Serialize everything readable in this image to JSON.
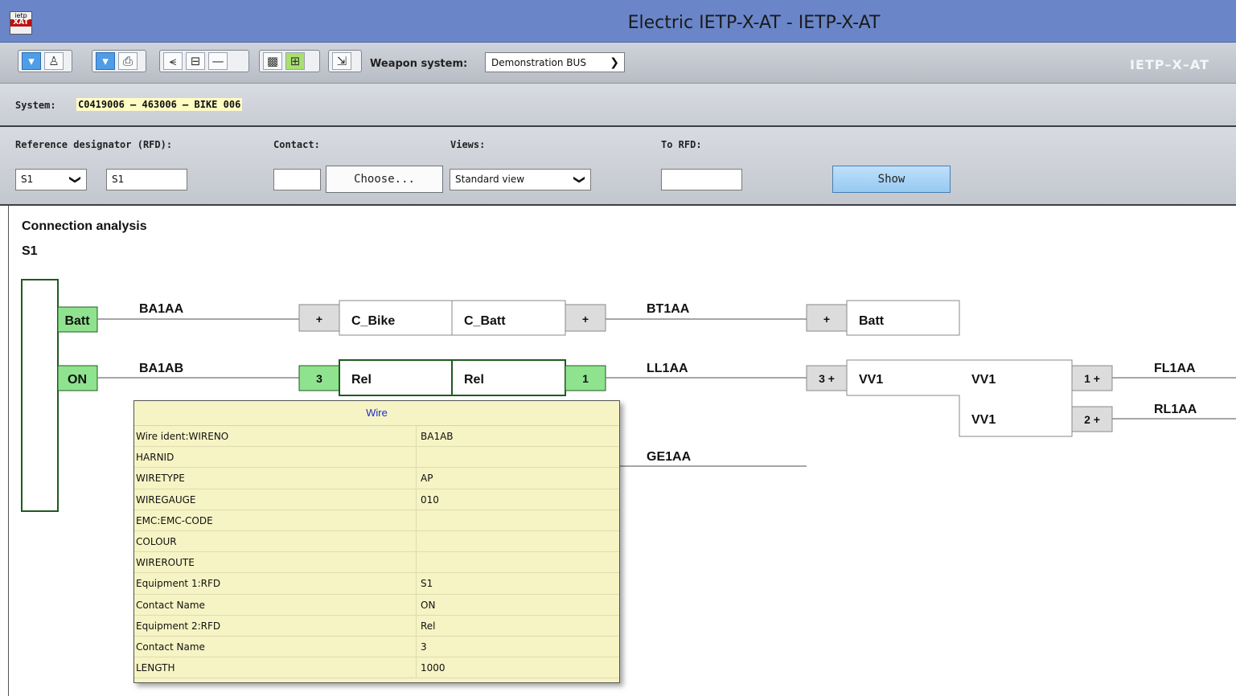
{
  "window": {
    "title": "Electric IETP-X-AT - IETP-X-AT",
    "logo_top": "ietp",
    "logo_bottom": "XAT"
  },
  "toolbar": {
    "weapon_label": "Weapon system:",
    "weapon_value": "Demonstration BUS",
    "brand": "IETP–X–AT"
  },
  "system": {
    "label": "System:",
    "value": "C0419006 – 463006 – BIKE 006"
  },
  "form": {
    "rfd_label": "Reference designator (RFD):",
    "rfd_select": "S1",
    "rfd_value": "S1",
    "contact_label": "Contact:",
    "contact_value": "",
    "choose_label": "Choose...",
    "views_label": "Views:",
    "views_value": "Standard view",
    "to_rfd_label": "To RFD:",
    "to_rfd_value": "",
    "show_label": "Show"
  },
  "content": {
    "heading": "Connection analysis",
    "subheading": "S1"
  },
  "diagram": {
    "pins_left": [
      "Batt",
      "ON"
    ],
    "wires": [
      "BA1AA",
      "BA1AB",
      "BT1AA",
      "LL1AA",
      "GE1AA",
      "FL1AA",
      "RL1AA"
    ],
    "pins": [
      "+",
      "+",
      "+",
      "3",
      "1",
      "3 +",
      "1 +",
      "2 +"
    ],
    "components": [
      "C_Bike",
      "C_Batt",
      "Batt",
      "Rel",
      "Rel",
      "VV1",
      "VV1",
      "VV1"
    ]
  },
  "popup": {
    "title": "Wire",
    "rows": [
      {
        "key": "Wire ident:WIRENO",
        "value": "BA1AB"
      },
      {
        "key": "HARNID",
        "value": ""
      },
      {
        "key": "WIRETYPE",
        "value": "AP"
      },
      {
        "key": "WIREGAUGE",
        "value": "010"
      },
      {
        "key": "EMC:EMC-CODE",
        "value": ""
      },
      {
        "key": "COLOUR",
        "value": ""
      },
      {
        "key": "WIREROUTE",
        "value": ""
      },
      {
        "key": "Equipment 1:RFD",
        "value": "S1"
      },
      {
        "key": "Contact Name",
        "value": "ON"
      },
      {
        "key": "Equipment 2:RFD",
        "value": "Rel"
      },
      {
        "key": "Contact Name",
        "value": "3"
      },
      {
        "key": "LENGTH",
        "value": "1000"
      }
    ]
  }
}
